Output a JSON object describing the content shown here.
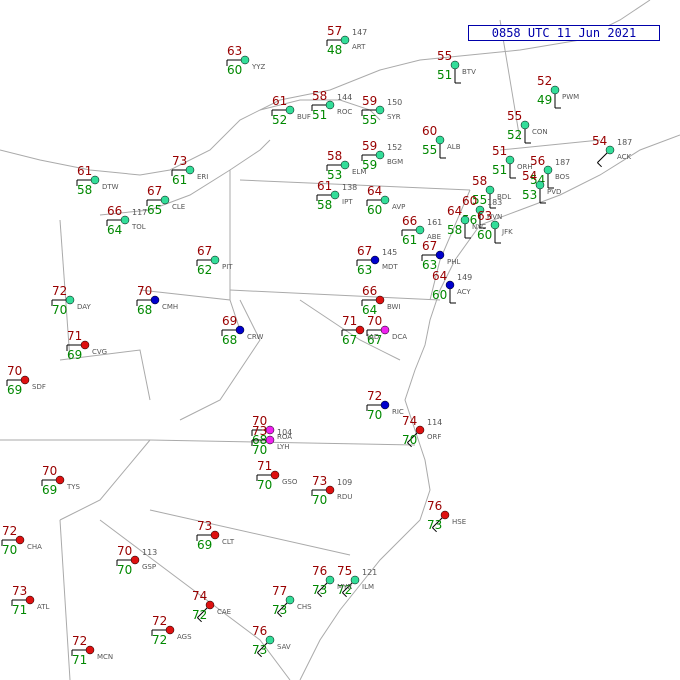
{
  "title": "0858 UTC 11 Jun 2021",
  "colors": {
    "border": "#aaaaaa",
    "temperature": "#990000",
    "dewpoint": "#008800",
    "pressure": "#555555",
    "sky_clear": "#33dd99",
    "sky_partial": "#dd1111",
    "sky_cloudy": "#0000cc",
    "sky_rain": "#ee22ee",
    "title_box": "#0000aa"
  },
  "stations": [
    {
      "id": "BOS",
      "temp": "56",
      "dew": "54",
      "pres": "187",
      "sky": "clear",
      "barb": "S"
    },
    {
      "id": "ACK",
      "temp": "54",
      "dew": "",
      "pres": "187",
      "sky": "clear",
      "barb": "SW"
    },
    {
      "id": "ORH",
      "temp": "51",
      "dew": "51",
      "pres": "",
      "sky": "clear",
      "barb": "S"
    },
    {
      "id": "PVD",
      "temp": "54",
      "dew": "53",
      "pres": "",
      "sky": "clear",
      "barb": "S"
    },
    {
      "id": "BDL",
      "temp": "58",
      "dew": "55",
      "pres": "",
      "sky": "clear",
      "barb": "S"
    },
    {
      "id": "HVN",
      "temp": "60",
      "dew": "56",
      "pres": "183",
      "sky": "clear",
      "barb": "S"
    },
    {
      "id": "ALB",
      "temp": "60",
      "dew": "55",
      "pres": "",
      "sky": "clear",
      "barb": "S"
    },
    {
      "id": "BGM",
      "temp": "59",
      "dew": "59",
      "pres": "152",
      "sky": "clear",
      "barb": "W"
    },
    {
      "id": "ELM",
      "temp": "58",
      "dew": "53",
      "pres": "",
      "sky": "clear",
      "barb": "W"
    },
    {
      "id": "SYR",
      "temp": "59",
      "dew": "55",
      "pres": "150",
      "sky": "clear",
      "barb": "W"
    },
    {
      "id": "ROC",
      "temp": "58",
      "dew": "51",
      "pres": "144",
      "sky": "clear",
      "barb": "W"
    },
    {
      "id": "BUF",
      "temp": "61",
      "dew": "52",
      "pres": "",
      "sky": "clear",
      "barb": "W"
    },
    {
      "id": "ERI",
      "temp": "73",
      "dew": "61",
      "pres": "",
      "sky": "clear",
      "barb": "W"
    },
    {
      "id": "PIT",
      "temp": "67",
      "dew": "62",
      "pres": "",
      "sky": "clear",
      "barb": "W"
    },
    {
      "id": "IPT",
      "temp": "61",
      "dew": "58",
      "pres": "138",
      "sky": "clear",
      "barb": "W"
    },
    {
      "id": "AVP",
      "temp": "64",
      "dew": "60",
      "pres": "",
      "sky": "clear",
      "barb": "W"
    },
    {
      "id": "ABE",
      "temp": "66",
      "dew": "61",
      "pres": "161",
      "sky": "clear",
      "barb": "W"
    },
    {
      "id": "MDT",
      "temp": "67",
      "dew": "63",
      "pres": "145",
      "sky": "cloudy",
      "barb": "W"
    },
    {
      "id": "PHL",
      "temp": "67",
      "dew": "63",
      "pres": "",
      "sky": "cloudy",
      "barb": "W"
    },
    {
      "id": "NYC",
      "temp": "64",
      "dew": "58",
      "pres": "",
      "sky": "clear",
      "barb": "S"
    },
    {
      "id": "JFK",
      "temp": "63",
      "dew": "60",
      "pres": "",
      "sky": "clear",
      "barb": "S"
    },
    {
      "id": "ACY",
      "temp": "64",
      "dew": "60",
      "pres": "149",
      "sky": "cloudy",
      "barb": "S"
    },
    {
      "id": "BWI",
      "temp": "66",
      "dew": "64",
      "pres": "",
      "sky": "partial",
      "barb": "W"
    },
    {
      "id": "DCA",
      "temp": "70",
      "dew": "67",
      "pres": "",
      "sky": "rain",
      "barb": "W"
    },
    {
      "id": "IAD",
      "temp": "71",
      "dew": "67",
      "pres": "",
      "sky": "partial",
      "barb": "W"
    },
    {
      "id": "RIC",
      "temp": "72",
      "dew": "70",
      "pres": "",
      "sky": "cloudy",
      "barb": "W"
    },
    {
      "id": "ORF",
      "temp": "74",
      "dew": "70",
      "pres": "114",
      "sky": "partial",
      "barb": "SW"
    },
    {
      "id": "RDU",
      "temp": "73",
      "dew": "70",
      "pres": "109",
      "sky": "partial",
      "barb": "W"
    },
    {
      "id": "GSO",
      "temp": "71",
      "dew": "70",
      "pres": "",
      "sky": "partial",
      "barb": "W"
    },
    {
      "id": "CLT",
      "temp": "73",
      "dew": "69",
      "pres": "",
      "sky": "partial",
      "barb": "W"
    },
    {
      "id": "ILM",
      "temp": "75",
      "dew": "72",
      "pres": "121",
      "sky": "clear",
      "barb": "SW"
    },
    {
      "id": "HSE",
      "temp": "76",
      "dew": "73",
      "pres": "",
      "sky": "partial",
      "barb": "SW"
    },
    {
      "id": "CRW",
      "temp": "69",
      "dew": "68",
      "pres": "",
      "sky": "cloudy",
      "barb": "W"
    },
    {
      "id": "ROA",
      "temp": "70",
      "dew": "68",
      "pres": "",
      "sky": "rain",
      "barb": "W"
    },
    {
      "id": "LYH",
      "temp": "73",
      "dew": "70",
      "pres": "104",
      "sky": "rain",
      "barb": "W"
    },
    {
      "id": "CMH",
      "temp": "70",
      "dew": "68",
      "pres": "",
      "sky": "cloudy",
      "barb": "W"
    },
    {
      "id": "DAY",
      "temp": "72",
      "dew": "70",
      "pres": "",
      "sky": "clear",
      "barb": "W"
    },
    {
      "id": "CVG",
      "temp": "71",
      "dew": "69",
      "pres": "",
      "sky": "partial",
      "barb": "W"
    },
    {
      "id": "SDF",
      "temp": "70",
      "dew": "69",
      "pres": "",
      "sky": "partial",
      "barb": "W"
    },
    {
      "id": "TYS",
      "temp": "70",
      "dew": "69",
      "pres": "",
      "sky": "partial",
      "barb": "W"
    },
    {
      "id": "CHA",
      "temp": "72",
      "dew": "70",
      "pres": "",
      "sky": "partial",
      "barb": "W"
    },
    {
      "id": "ATL",
      "temp": "73",
      "dew": "71",
      "pres": "",
      "sky": "partial",
      "barb": "W"
    },
    {
      "id": "CAE",
      "temp": "74",
      "dew": "72",
      "pres": "",
      "sky": "partial",
      "barb": "SW"
    },
    {
      "id": "CHS",
      "temp": "77",
      "dew": "73",
      "pres": "",
      "sky": "clear",
      "barb": "SW"
    },
    {
      "id": "SAV",
      "temp": "76",
      "dew": "73",
      "pres": "",
      "sky": "clear",
      "barb": "SW"
    },
    {
      "id": "MYR",
      "temp": "76",
      "dew": "73",
      "pres": "",
      "sky": "clear",
      "barb": "SW"
    },
    {
      "id": "GSP",
      "temp": "70",
      "dew": "70",
      "pres": "113",
      "sky": "partial",
      "barb": "W"
    },
    {
      "id": "AGS",
      "temp": "72",
      "dew": "72",
      "pres": "",
      "sky": "partial",
      "barb": "W"
    },
    {
      "id": "MCN",
      "temp": "72",
      "dew": "71",
      "pres": "",
      "sky": "partial",
      "barb": "W"
    },
    {
      "id": "CLE",
      "temp": "67",
      "dew": "65",
      "pres": "",
      "sky": "clear",
      "barb": "W"
    },
    {
      "id": "DTW",
      "temp": "61",
      "dew": "58",
      "pres": "",
      "sky": "clear",
      "barb": "W"
    },
    {
      "id": "TOL",
      "temp": "66",
      "dew": "64",
      "pres": "117",
      "sky": "clear",
      "barb": "W"
    },
    {
      "id": "YYZ",
      "temp": "63",
      "dew": "60",
      "pres": "",
      "sky": "clear",
      "barb": "W"
    },
    {
      "id": "ART",
      "temp": "57",
      "dew": "48",
      "pres": "147",
      "sky": "clear",
      "barb": "W"
    },
    {
      "id": "BTV",
      "temp": "55",
      "dew": "51",
      "pres": "",
      "sky": "clear",
      "barb": "S"
    },
    {
      "id": "PWM",
      "temp": "52",
      "dew": "49",
      "pres": "",
      "sky": "clear",
      "barb": "S"
    },
    {
      "id": "CON",
      "temp": "55",
      "dew": "52",
      "pres": "",
      "sky": "clear",
      "barb": "S"
    }
  ]
}
